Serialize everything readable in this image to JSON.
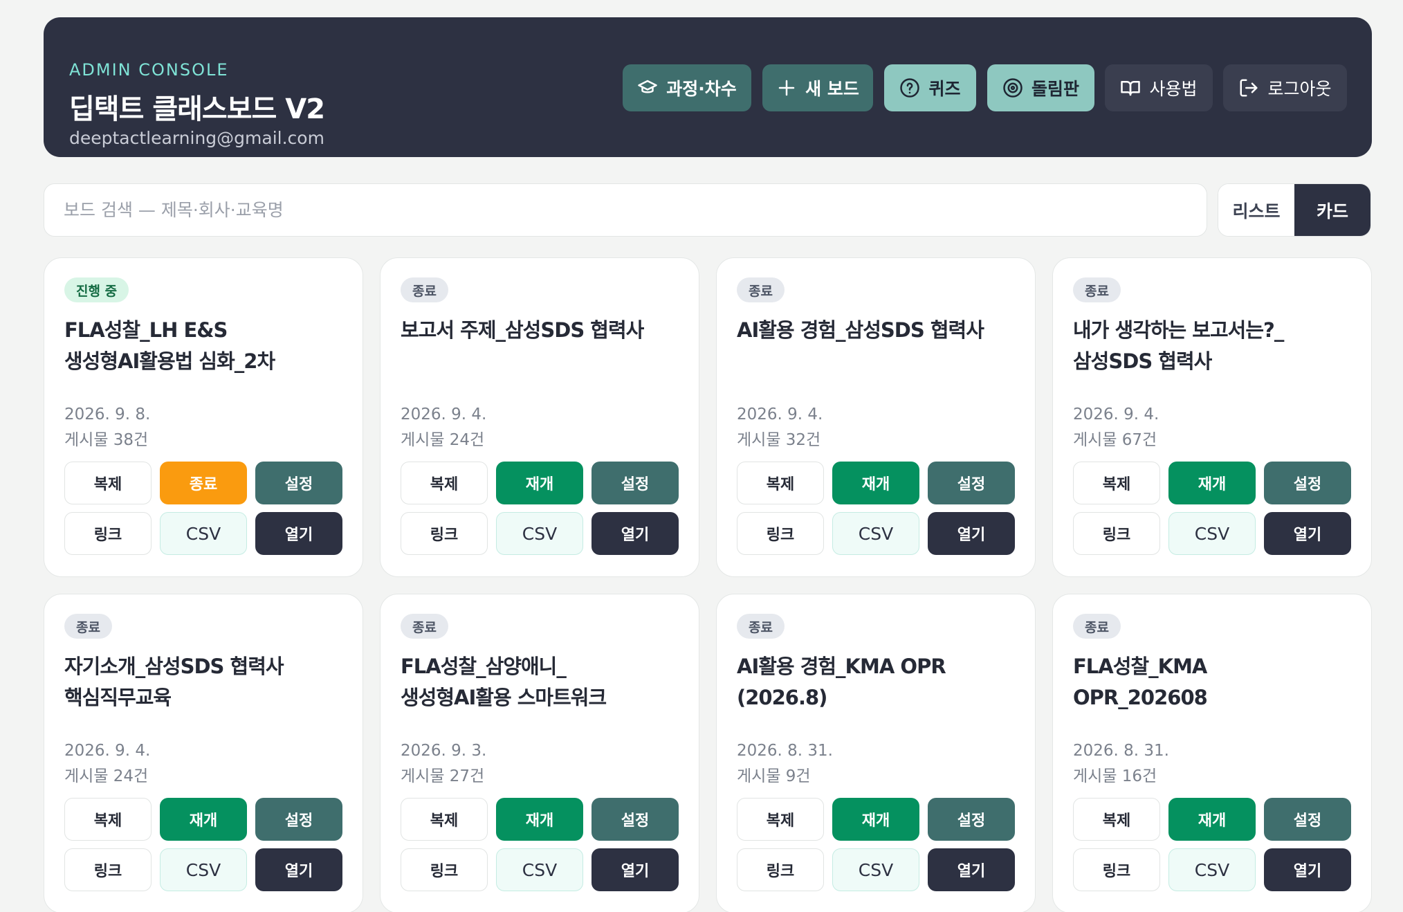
{
  "header": {
    "eyebrow": "ADMIN CONSOLE",
    "title": "딥택트 클래스보드 V2",
    "email": "deeptactlearning@gmail.com",
    "buttons": [
      {
        "label": "과정·차수",
        "icon": "graduation-cap-icon"
      },
      {
        "label": "새 보드",
        "icon": "plus-icon"
      },
      {
        "label": "퀴즈",
        "icon": "question-circle-icon"
      },
      {
        "label": "돌림판",
        "icon": "wheel-icon"
      },
      {
        "label": "사용법",
        "icon": "book-icon"
      },
      {
        "label": "로그아웃",
        "icon": "logout-icon"
      }
    ]
  },
  "search": {
    "placeholder": "보드 검색 — 제목·회사·교육명",
    "value": ""
  },
  "view_toggle": {
    "list": "리스트",
    "card": "카드",
    "selected": "카드"
  },
  "colors": {
    "header_bg": "#2d3142",
    "accent_teal": "#3f6e6d",
    "accent_mint": "#8ec8c0",
    "resume_green": "#05915f",
    "end_orange": "#fa9b0f"
  },
  "card_labels": {
    "copy": "복제",
    "settings": "설정",
    "link": "링크",
    "csv": "CSV",
    "open": "열기"
  },
  "cards": [
    {
      "status": "진행 중",
      "status_type": "active",
      "title": "FLA성찰_LH E&S\n생성형AI활용법 심화_2차",
      "date": "2026. 9. 8.",
      "count": "게시물 38건",
      "toggle": "종료",
      "toggle_type": "end"
    },
    {
      "status": "종료",
      "status_type": "ended",
      "title": "보고서 주제_삼성SDS 협력사",
      "date": "2026. 9. 4.",
      "count": "게시물 24건",
      "toggle": "재개",
      "toggle_type": "resume"
    },
    {
      "status": "종료",
      "status_type": "ended",
      "title": "AI활용 경험_삼성SDS 협력사",
      "date": "2026. 9. 4.",
      "count": "게시물 32건",
      "toggle": "재개",
      "toggle_type": "resume"
    },
    {
      "status": "종료",
      "status_type": "ended",
      "title": "내가 생각하는 보고서는?_\n삼성SDS 협력사",
      "date": "2026. 9. 4.",
      "count": "게시물 67건",
      "toggle": "재개",
      "toggle_type": "resume"
    },
    {
      "status": "종료",
      "status_type": "ended",
      "title": "자기소개_삼성SDS 협력사\n핵심직무교육",
      "date": "2026. 9. 4.",
      "count": "게시물 24건",
      "toggle": "재개",
      "toggle_type": "resume"
    },
    {
      "status": "종료",
      "status_type": "ended",
      "title": "FLA성찰_삼양애니_\n생성형AI활용 스마트워크",
      "date": "2026. 9. 3.",
      "count": "게시물 27건",
      "toggle": "재개",
      "toggle_type": "resume"
    },
    {
      "status": "종료",
      "status_type": "ended",
      "title": "AI활용 경험_KMA OPR\n(2026.8)",
      "date": "2026. 8. 31.",
      "count": "게시물 9건",
      "toggle": "재개",
      "toggle_type": "resume"
    },
    {
      "status": "종료",
      "status_type": "ended",
      "title": "FLA성찰_KMA\nOPR_202608",
      "date": "2026. 8. 31.",
      "count": "게시물 16건",
      "toggle": "재개",
      "toggle_type": "resume"
    }
  ]
}
